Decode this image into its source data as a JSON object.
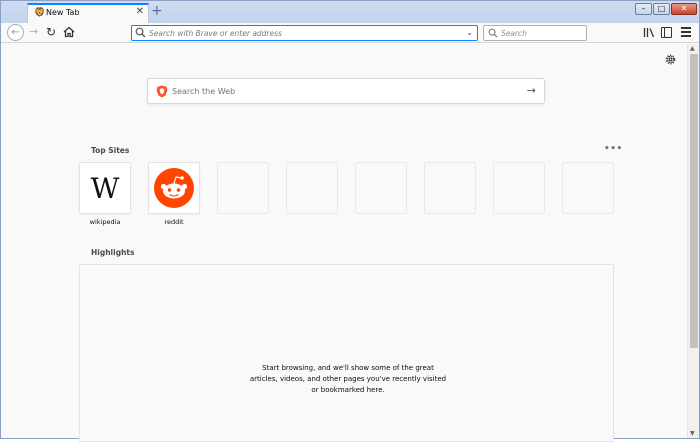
{
  "tab": {
    "title": "New Tab",
    "favicon": "brave-icon",
    "close_glyph": "✕",
    "new_tab_glyph": "+"
  },
  "window_controls": {
    "minimize": "–",
    "maximize": "□",
    "close": "✕"
  },
  "nav": {
    "back_glyph": "←",
    "forward_glyph": "→",
    "reload_glyph": "↻",
    "url_placeholder": "Search with Brave or enter address",
    "url_value": "",
    "search_placeholder": "Search",
    "dropdown_glyph": "⌄"
  },
  "newtab": {
    "web_search_placeholder": "Search the Web",
    "go_glyph": "→",
    "top_sites_title": "Top Sites",
    "more_glyph": "•••",
    "highlights_title": "Highlights",
    "highlights_empty_text": "Start browsing, and we'll show some of the great articles, videos, and other pages you've recently visited or bookmarked here.",
    "top_sites": [
      {
        "label": "wikipedia",
        "logo": "wikipedia-logo",
        "glyph": "W"
      },
      {
        "label": "reddit",
        "logo": "reddit-logo"
      },
      {
        "label": ""
      },
      {
        "label": ""
      },
      {
        "label": ""
      },
      {
        "label": ""
      },
      {
        "label": ""
      },
      {
        "label": ""
      }
    ]
  },
  "colors": {
    "accent": "#0a84ff",
    "reddit": "#ff4500",
    "brave": "#fb542b"
  }
}
